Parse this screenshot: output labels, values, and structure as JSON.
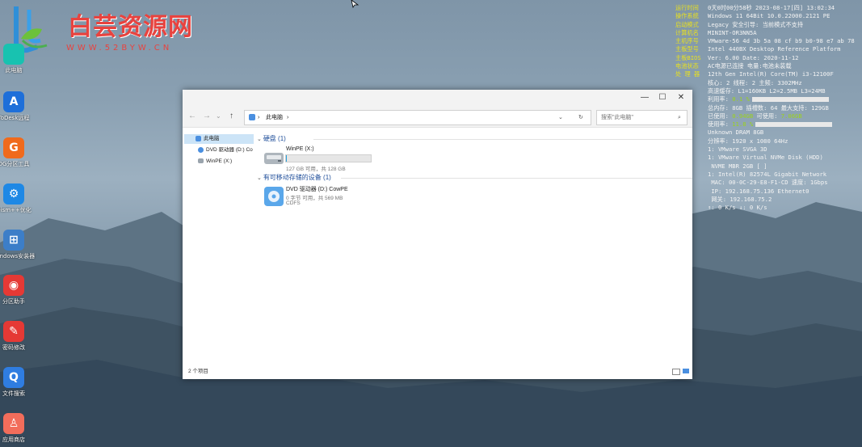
{
  "watermark": {
    "title": "白芸资源网",
    "url": "WWW.52BYW.CN"
  },
  "desktop_icons": [
    {
      "label": "此电脑",
      "color": "#18c2b0",
      "glyph": "",
      "icon": "swirl-icon"
    },
    {
      "label": "ToDesk远程",
      "color": "#1e6fd9",
      "glyph": "A",
      "icon": "todesk-icon"
    },
    {
      "label": "DG分区工具",
      "color": "#f06a1c",
      "glyph": "G",
      "icon": "diskgenius-icon"
    },
    {
      "label": "Dism++优化",
      "color": "#1e88e5",
      "glyph": "⚙",
      "icon": "dism-icon"
    },
    {
      "label": "Windows安装器",
      "color": "#3c7ec8",
      "glyph": "⊞",
      "icon": "windows-installer-icon"
    },
    {
      "label": "分区助手",
      "color": "#e53935",
      "glyph": "◉",
      "icon": "partition-assistant-icon"
    },
    {
      "label": "密码修改",
      "color": "#e53935",
      "glyph": "✎",
      "icon": "password-icon"
    },
    {
      "label": "文件搜索",
      "color": "#2f7de1",
      "glyph": "Q",
      "icon": "file-search-icon"
    },
    {
      "label": "应用商店",
      "color": "#f26d5b",
      "glyph": "♙",
      "icon": "app-store-icon"
    }
  ],
  "bginfo": [
    {
      "k": "运行时间",
      "v": "0天0时00分58秒  2023-08-17[四] 13:02:34"
    },
    {
      "k": "操作系统",
      "v": "Windows 11 64Bit 10.0.22000.2121 PE"
    },
    {
      "k": "启动模式",
      "v": "Legacy        安全引导: 当前模式不支持"
    },
    {
      "k": "计算机名",
      "v": "MININT-OR3NN5A"
    },
    {
      "k": "主机序号",
      "v": "VMware-56 4d 3b 5a 08 cf b9 b0-98 e7 ab 78"
    },
    {
      "k": "主板型号",
      "v": "Intel 440BX Desktop Reference Platform"
    },
    {
      "k": "主板BIOS",
      "v": "Ver: 6.00  Date: 2020-11-12"
    },
    {
      "k": "电池状态",
      "v": "AC电源已连接 电量:电池未装载"
    },
    {
      "k": "处 理 器",
      "v": "12th Gen Intel(R) Core(TM) i3-12100F"
    },
    {
      "k": "",
      "v": "核心: 2  线程: 2        主频: 3302MHz"
    },
    {
      "k": "",
      "v": "高速缓存: L1=160KB L2=2.5MB L3=24MB"
    },
    {
      "k": "",
      "v": "利用率:",
      "g": "0.1 %",
      "bar": 95
    },
    {
      "k": "内 存",
      "v": "总内存: 8GB 插槽数: 64 最大支持: 129GB"
    },
    {
      "k": "",
      "v": "已使用:",
      "g": "0.94GB",
      "v2": "  可使用:",
      "g2": "7.06GB"
    },
    {
      "k": "",
      "v": "使用率:",
      "g": "11.8 %",
      "bar": 95
    },
    {
      "k": "",
      "v": "Unknown DRAM 8GB"
    },
    {
      "k": "显 卡",
      "v": "分辨率: 1920 x 1080 64Hz"
    },
    {
      "k": "",
      "v": "1: VMware SVGA 3D"
    },
    {
      "k": "硬 盘",
      "v": "1: VMware Virtual NVMe Disk (HDD)"
    },
    {
      "k": "",
      "v": "   NVME MBR 2GB [ ]"
    },
    {
      "k": "网 络",
      "v": "1: Intel(R) 82574L Gigabit Network"
    },
    {
      "k": "",
      "v": "   MAC: 00-0C-29-E8-F1-CD 速度: 1Gbps"
    },
    {
      "k": "",
      "v": "   IP: 192.168.75.136 Ethernet0"
    },
    {
      "k": "",
      "v": "   网关: 192.168.75.2"
    },
    {
      "k": "网 速",
      "v": "↑: 0 K/s        ↓: 0 K/s"
    }
  ],
  "explorer": {
    "address_segments": [
      "此电脑",
      "›"
    ],
    "search_placeholder": "搜索\"此电脑\"",
    "nav_items": [
      "此电脑",
      "DVD 驱动器 (D:) Co",
      "WinPE (X:)"
    ],
    "groups": [
      {
        "title": "硬盘 (1)"
      },
      {
        "title": "有可移动存储的设备 (1)"
      }
    ],
    "drives": [
      {
        "name": "WinPE (X:)",
        "sub": "127 GB 可用，共 128 GB",
        "used_fraction": 0.01
      },
      {
        "name": "DVD 驱动器 (D:) CowPE",
        "sub": "0 字节 可用，共 569 MB",
        "sub2": "CDFS"
      }
    ],
    "status_text": "2 个项目"
  }
}
